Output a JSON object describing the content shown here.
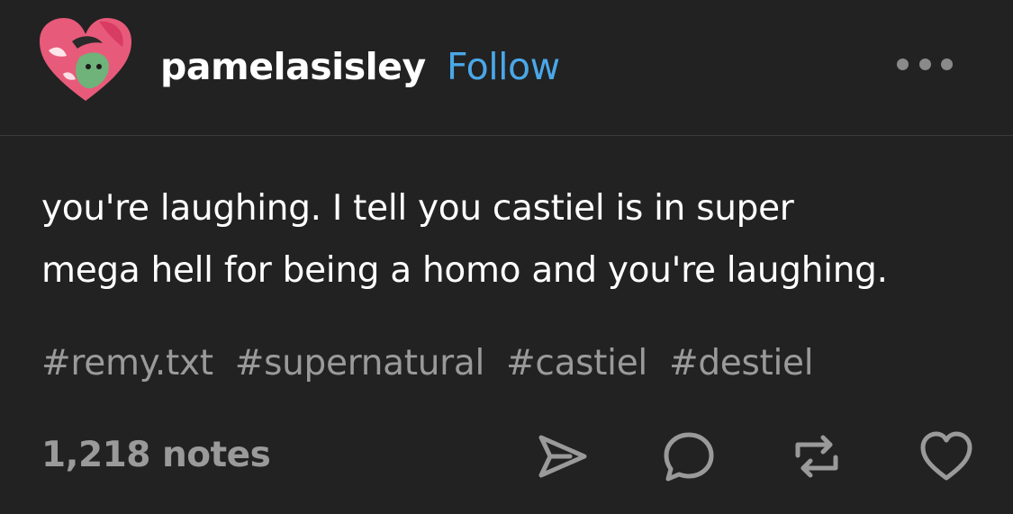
{
  "post": {
    "username": "pamelasisley",
    "follow_label": "Follow",
    "avatar_icon": "avatar-heart-icon",
    "more_icon": "more-options-icon",
    "text_line1": "you're laughing. I tell you castiel is in super",
    "text_line2": "mega hell for being a homo and you're laughing.",
    "tags": [
      "#remy.txt",
      "#supernatural",
      "#castiel",
      "#destiel"
    ],
    "notes_label": "1,218 notes",
    "actions": [
      "share-icon",
      "reply-icon",
      "reblog-icon",
      "like-icon"
    ]
  },
  "colors": {
    "background": "#222222",
    "text": "#ffffff",
    "muted": "#9a9a9a",
    "follow_link": "#4aa7e8",
    "avatar_heart": "#e85a7a"
  }
}
